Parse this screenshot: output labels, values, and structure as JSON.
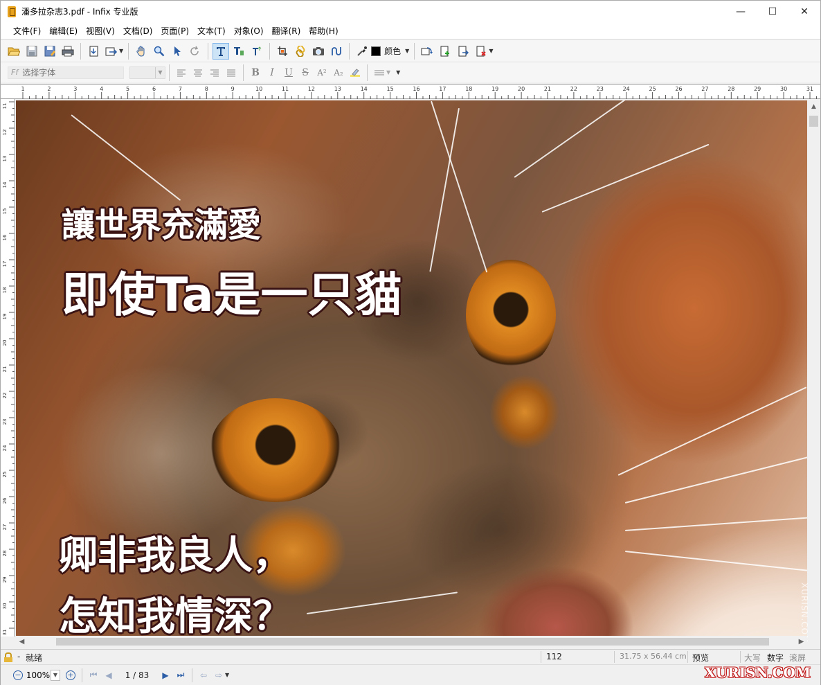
{
  "window": {
    "title": "潘多拉杂志3.pdf - Infix 专业版",
    "controls": [
      "—",
      "☐",
      "✕"
    ]
  },
  "menu": [
    "文件(F)",
    "编辑(E)",
    "视图(V)",
    "文档(D)",
    "页面(P)",
    "文本(T)",
    "对象(O)",
    "翻译(R)",
    "帮助(H)"
  ],
  "toolbar": {
    "color_label": "颜色",
    "color_value": "#000000"
  },
  "format": {
    "font_placeholder": "选择字体",
    "bold": "B",
    "italic": "I",
    "underline": "U",
    "strike": "S",
    "superscript": "A²",
    "subscript": "A₂"
  },
  "ruler": {
    "top_ticks": [
      "1",
      "2",
      "3",
      "4",
      "5",
      "6",
      "7",
      "8",
      "9",
      "10",
      "11",
      "12",
      "13",
      "14",
      "15",
      "16",
      "17",
      "18",
      "19",
      "20",
      "21",
      "22",
      "23",
      "24",
      "25",
      "26",
      "27",
      "28",
      "29",
      "30",
      "31"
    ],
    "left_ticks": [
      "11",
      "12",
      "13",
      "14",
      "15",
      "16",
      "17",
      "18",
      "19",
      "20",
      "21",
      "22",
      "23",
      "24",
      "25",
      "26",
      "27",
      "28",
      "29",
      "30",
      "31"
    ]
  },
  "page": {
    "line1": "讓世界充滿愛",
    "line2": "即使Ta是一只貓",
    "line3": "卿非我良人，",
    "line4": "怎知我情深？"
  },
  "status": {
    "state": "就绪",
    "object_id": "112",
    "page_size": "31.75 x 56.44 cm",
    "mode": "预览",
    "caps": "大写",
    "num": "数字",
    "scroll": "滚屏"
  },
  "nav": {
    "zoom": "100%",
    "page": "1 / 83"
  },
  "watermark": {
    "text": "XURISN.COM",
    "vertical": "XURISN.COM"
  }
}
